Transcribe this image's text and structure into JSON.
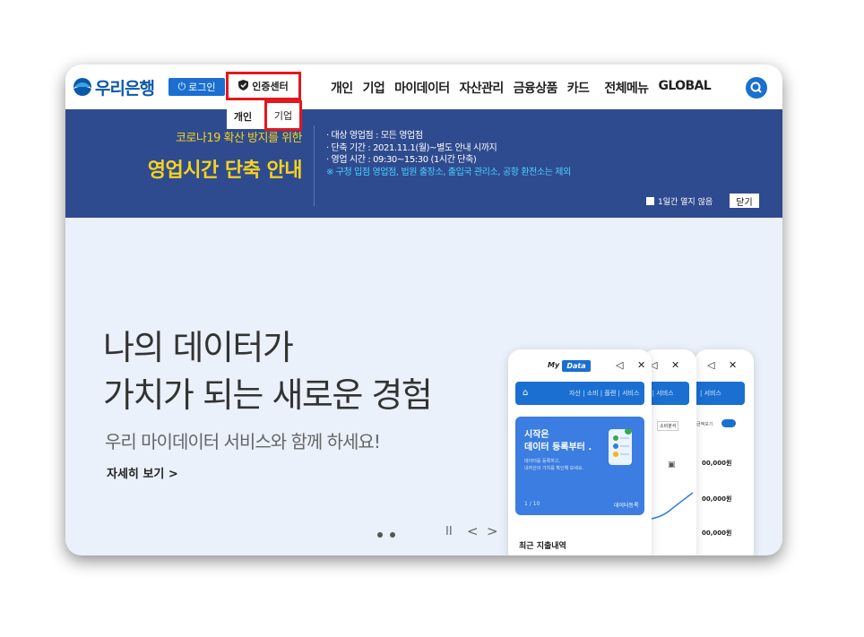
{
  "header": {
    "logo_text": "우리은행",
    "login_label": "로그인",
    "cert_label": "인증센터",
    "nav": [
      "개인",
      "기업",
      "마이데이터",
      "자산관리",
      "금융상품",
      "카드",
      "전체메뉴",
      "GLOBAL"
    ],
    "icons": {
      "login": "power-icon",
      "cert": "shield-icon",
      "search": "search-icon"
    }
  },
  "cert_dropdown": {
    "items": [
      "개인",
      "기업"
    ]
  },
  "notice": {
    "subtitle": "코로나19 확산 방지를 위한",
    "title": "영업시간 단축 안내",
    "lines": [
      "· 대상 영업점 : 모든 영업점",
      "· 단축 기간 : 2021.11.1(월)~별도 안내 시까지",
      "· 영업 시간 : 09:30~15:30 (1시간 단축)"
    ],
    "warning": "※ 구청 입점 영업점, 법원 출장소, 출입국 관리소, 공항 환전소는 제외",
    "hide_option": "1일간 열지 않음",
    "close_label": "닫기"
  },
  "hero": {
    "line1": "나의 데이터가",
    "line2": "가치가 되는 새로운 경험",
    "subtitle": "우리 마이데이터 서비스와 함께 하세요!",
    "more_link": "자세히 보기 >"
  },
  "slider": {
    "pause": "II",
    "prev": "<",
    "next": ">"
  },
  "phone_a": {
    "brand_my": "My",
    "brand_data": "Data",
    "icons": "◁ ✕",
    "home": "⌂",
    "tabs": "자산 | 소비 | 플랜 | 서비스",
    "card_title_1": "시작은",
    "card_title_2": "데이터 등록부터 .",
    "card_desc_1": "데이터를 등록하고,",
    "card_desc_2": "내자산의 가치를 확인해 보세요.",
    "card_page": "1 / 10",
    "card_register": "데이터등록",
    "recent_label": "최근 지출내역"
  },
  "phone_b": {
    "icons": "◁ ✕",
    "tab": "랜 | 서비스",
    "chip": "소비분석",
    "square": "▣"
  },
  "phone_c": {
    "icons": "◁ ✕",
    "tab": "| 서비스",
    "toggle_label": "금액보기",
    "amounts": [
      "00,000원",
      "00,000원",
      "00,000원"
    ]
  },
  "colors": {
    "brand_blue": "#0b58a8",
    "accent_blue": "#1a6fd1",
    "notice_bg": "#2f4b8f",
    "notice_yellow": "#f7d31b",
    "highlight_red": "#e3171d"
  }
}
